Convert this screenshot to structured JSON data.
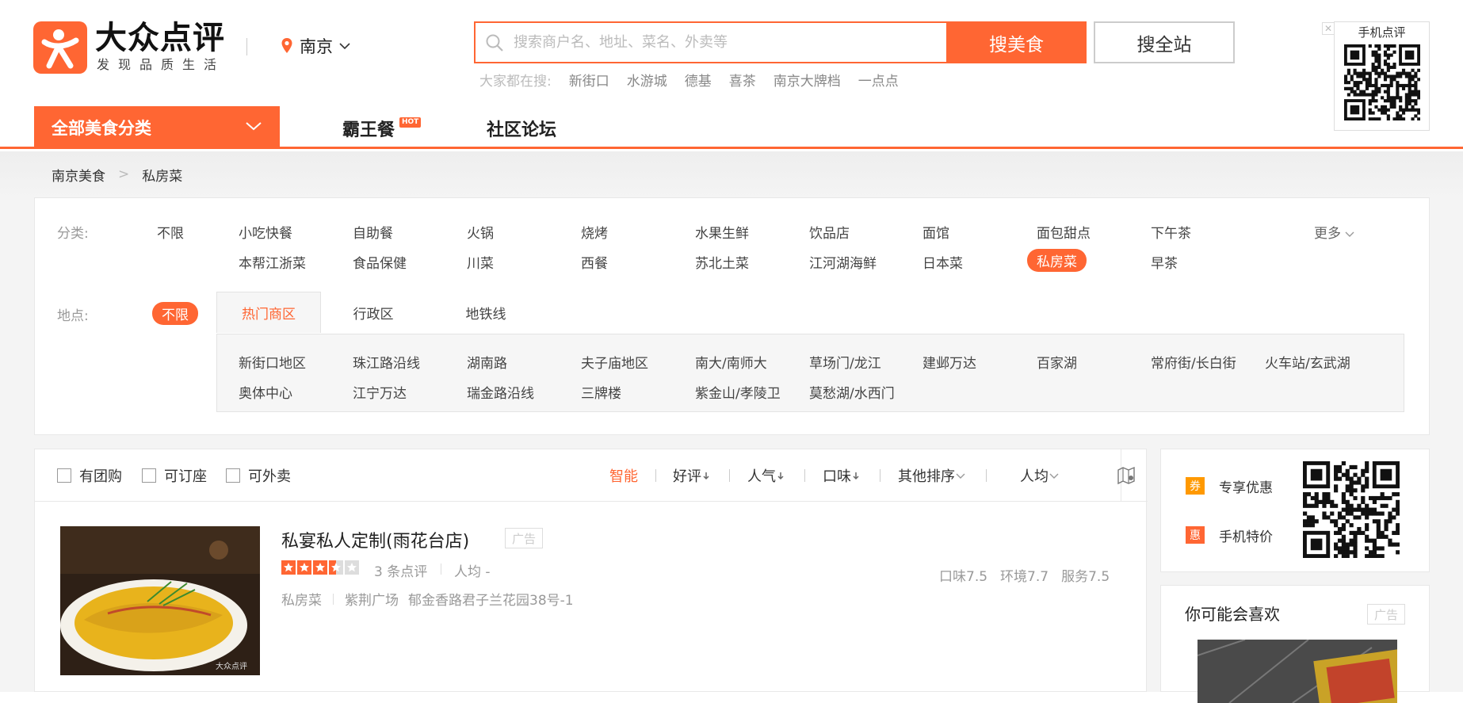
{
  "header": {
    "brand": "大众点评",
    "slogan": "发现品质生活",
    "city": "南京",
    "search": {
      "placeholder": "搜索商户名、地址、菜名、外卖等",
      "value": "",
      "primary_button": "搜美食",
      "secondary_button": "搜全站"
    },
    "hot_label": "大家都在搜:",
    "hot_keywords": [
      "新街口",
      "水游城",
      "德基",
      "喜茶",
      "南京大牌档",
      "一点点"
    ],
    "qr_caption": "手机点评",
    "qr_close": "✕"
  },
  "nav": {
    "category_button": "全部美食分类",
    "links": [
      "霸王餐",
      "社区论坛"
    ],
    "hot_badge": "HOT"
  },
  "breadcrumb": [
    "南京美食",
    "私房菜"
  ],
  "filters": {
    "category_label": "分类:",
    "category_all": "不限",
    "categories_row1": [
      "小吃快餐",
      "自助餐",
      "火锅",
      "烧烤",
      "水果生鲜",
      "饮品店",
      "面馆",
      "面包甜点",
      "下午茶"
    ],
    "categories_row2": [
      "本帮江浙菜",
      "食品保健",
      "川菜",
      "西餐",
      "苏北土菜",
      "江河湖海鲜",
      "日本菜",
      "私房菜",
      "早茶"
    ],
    "selected_category": "私房菜",
    "more": "更多",
    "location_label": "地点:",
    "location_all": "不限",
    "location_tabs": [
      "热门商区",
      "行政区",
      "地铁线"
    ],
    "areas_row1": [
      "新街口地区",
      "珠江路沿线",
      "湖南路",
      "夫子庙地区",
      "南大/南师大",
      "草场门/龙江",
      "建邺万达",
      "百家湖",
      "常府街/长白街",
      "火车站/玄武湖"
    ],
    "areas_row2": [
      "奥体中心",
      "江宁万达",
      "瑞金路沿线",
      "三牌楼",
      "紫金山/孝陵卫",
      "莫愁湖/水西门"
    ]
  },
  "toolbar": {
    "checkboxes": [
      "有团购",
      "可订座",
      "可外卖"
    ],
    "sorts": [
      "智能",
      "好评",
      "人气",
      "口味",
      "其他排序",
      "人均"
    ],
    "active_sort": "智能"
  },
  "shop": {
    "name": "私宴私人定制(雨花台店)",
    "ad": "广告",
    "rating_stars": 3.5,
    "reviews": "3 条点评",
    "avg_price": "人均 -",
    "scores": [
      "口味7.5",
      "环境7.7",
      "服务7.5"
    ],
    "category": "私房菜",
    "area": "紫荆广场",
    "address": "郁金香路君子兰花园38号-1",
    "watermark": "大众点评"
  },
  "sidebar": {
    "promos": [
      {
        "icon": "券",
        "label": "专享优惠"
      },
      {
        "icon": "惠",
        "label": "手机特价"
      }
    ],
    "recommend_title": "你可能会喜欢",
    "recommend_ad": "广告"
  },
  "colors": {
    "accent": "#ff6633"
  }
}
